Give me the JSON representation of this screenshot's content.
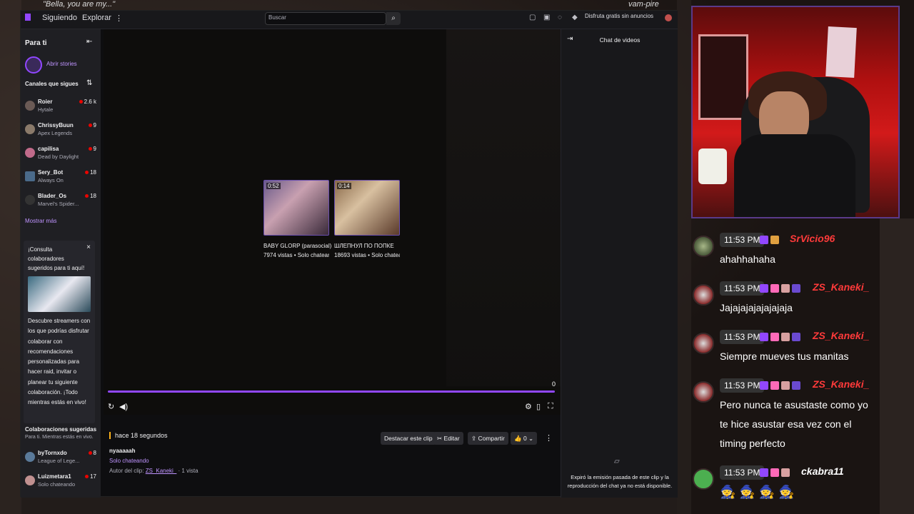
{
  "collage": {
    "quote_left": "\"Bella, you are my...\"",
    "quote_right": "vam-pire"
  },
  "topbar": {
    "following": "Siguiendo",
    "explore": "Explorar",
    "search_placeholder": "Buscar",
    "promo": "Disfruta gratis sin anuncios"
  },
  "sidebar": {
    "title": "Para ti",
    "stories": "Abrir stories",
    "followed_heading": "Canales que sigues",
    "channels": [
      {
        "name": "Roier",
        "game": "Hytale",
        "viewers": "2.6 k"
      },
      {
        "name": "ChrissyBuun",
        "game": "Apex Legends",
        "viewers": "9"
      },
      {
        "name": "capilisa",
        "game": "Dead by Daylight",
        "viewers": "9"
      },
      {
        "name": "Sery_Bot",
        "game": "Always On",
        "viewers": "18"
      },
      {
        "name": "Blader_Os",
        "game": "Marvel's Spider...",
        "viewers": "18"
      }
    ],
    "show_more": "Mostrar más",
    "promo": {
      "title": "¡Consulta colaboradores sugeridos para ti aquí!",
      "description": "Descubre streamers con los que podrías disfrutar colaborar con recomendaciones personalizadas para hacer raid, invitar o planear tu siguiente colaboración. ¡Todo mientras estás en vivo!"
    },
    "suggested_heading": "Colaboraciones sugeridas",
    "suggested_sub": "Para ti. Mientras estás en vivo.",
    "suggested": [
      {
        "name": "byTornxdo",
        "game": "League of Lege...",
        "viewers": "8"
      },
      {
        "name": "Luizmetara1",
        "game": "Solo chateando",
        "viewers": "17"
      }
    ]
  },
  "player": {
    "time": "0",
    "recommendations": [
      {
        "duration": "0:52",
        "title": "BABY GLORP (parasocial)",
        "meta": "7974 vistas • Solo chateando"
      },
      {
        "duration": "0:14",
        "title": "ШЛЕПНУЛ ПО ПОПКЕ",
        "meta": "18693 vistas • Solo chatean..."
      }
    ]
  },
  "clip": {
    "ago": "hace 18 segundos",
    "title": "nyaaaaah",
    "category": "Solo chateando",
    "author_label": "Autor del clip: ",
    "author": "ZS_Kaneki_",
    "views": " · 1 vista",
    "feature_label": "Destacar este clip",
    "edit_label": "Editar",
    "share_label": "Compartir",
    "likes": "0"
  },
  "chatpanel": {
    "title": "Chat de videos",
    "message": "Expiró la emisión pasada de este clip y la reproducción del chat ya no está disponible."
  },
  "overlay": {
    "messages": [
      {
        "time": "11:53 PM",
        "user": "SrVicio96",
        "text": "ahahhahaha"
      },
      {
        "time": "11:53 PM",
        "user": "ZS_Kaneki_",
        "text": "Jajajajajajajajaja"
      },
      {
        "time": "11:53 PM",
        "user": "ZS_Kaneki_",
        "text": "Siempre mueves tus manitas"
      },
      {
        "time": "11:53 PM",
        "user": "ZS_Kaneki_",
        "text": "Pero nunca te asustaste como yo te hice asustar esa vez con el timing perfecto"
      },
      {
        "time": "11:53 PM",
        "user": "ckabra11",
        "text": "🧙 🧙 🧙 🧙"
      }
    ]
  }
}
